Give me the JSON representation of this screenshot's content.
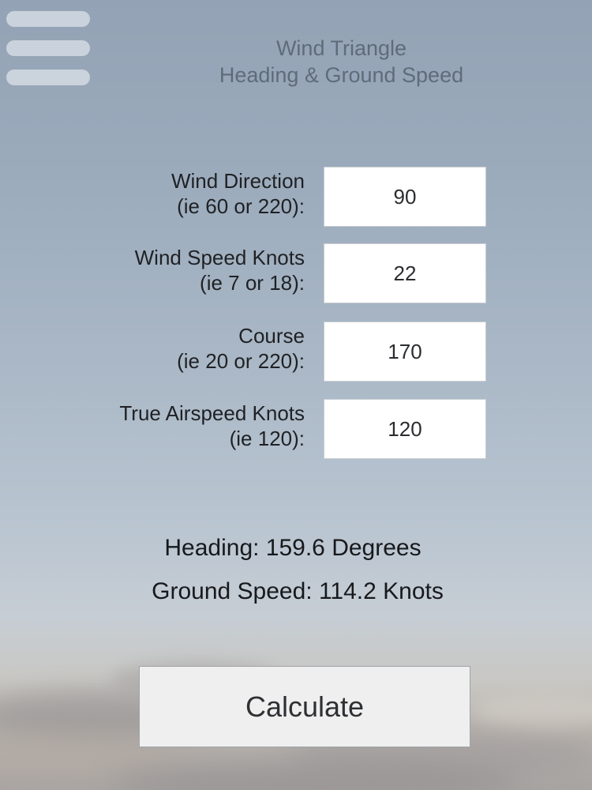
{
  "menu": {
    "icon": "hamburger-menu-icon"
  },
  "header": {
    "title_line1": "Wind Triangle",
    "title_line2": "Heading & Ground Speed"
  },
  "fields": [
    {
      "label_line1": "Wind Direction",
      "label_line2": "(ie 60 or 220):",
      "value": "90"
    },
    {
      "label_line1": "Wind Speed Knots",
      "label_line2": "(ie 7 or 18):",
      "value": "22"
    },
    {
      "label_line1": "Course",
      "label_line2": "(ie 20 or 220):",
      "value": "170"
    },
    {
      "label_line1": "True Airspeed Knots",
      "label_line2": "(ie 120):",
      "value": "120"
    }
  ],
  "results": {
    "heading": "Heading: 159.6 Degrees",
    "ground_speed": "Ground Speed: 114.2 Knots"
  },
  "actions": {
    "calculate_label": "Calculate"
  },
  "colors": {
    "sky_top": "#93a3b5",
    "sky_bottom": "#a8a4a2",
    "title_text": "#5f6b78",
    "button_bg": "#efefef"
  }
}
